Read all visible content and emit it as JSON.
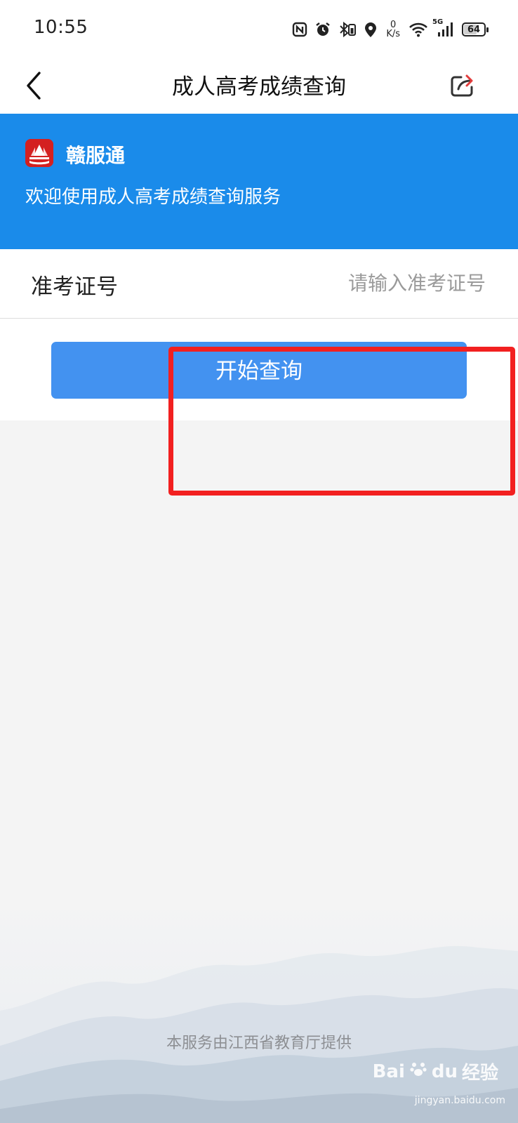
{
  "status_bar": {
    "time": "10:55",
    "net_speed_value": "0",
    "net_speed_unit": "K/s",
    "network_type": "5G",
    "battery": "64",
    "icons": [
      "nfc-icon",
      "alarm-icon",
      "bluetooth-icon",
      "location-icon",
      "wifi-icon",
      "signal-icon",
      "battery-icon"
    ]
  },
  "nav": {
    "title": "成人高考成绩查询",
    "back_icon": "chevron-left-icon",
    "share_icon": "share-icon"
  },
  "banner": {
    "brand_name": "赣服通",
    "welcome": "欢迎使用成人高考成绩查询服务",
    "background": "#1a8bea"
  },
  "form": {
    "field_label": "准考证号",
    "field_placeholder": "请输入准考证号",
    "field_value": ""
  },
  "action": {
    "query_label": "开始查询",
    "button_color": "#4392f0"
  },
  "annotation": {
    "highlight_color": "#f22020"
  },
  "footer": {
    "provider": "本服务由江西省教育厅提供"
  },
  "watermark": {
    "brand": "Bai",
    "brand_suffix": "du",
    "label": "经验",
    "url": "jingyan.baidu.com"
  }
}
